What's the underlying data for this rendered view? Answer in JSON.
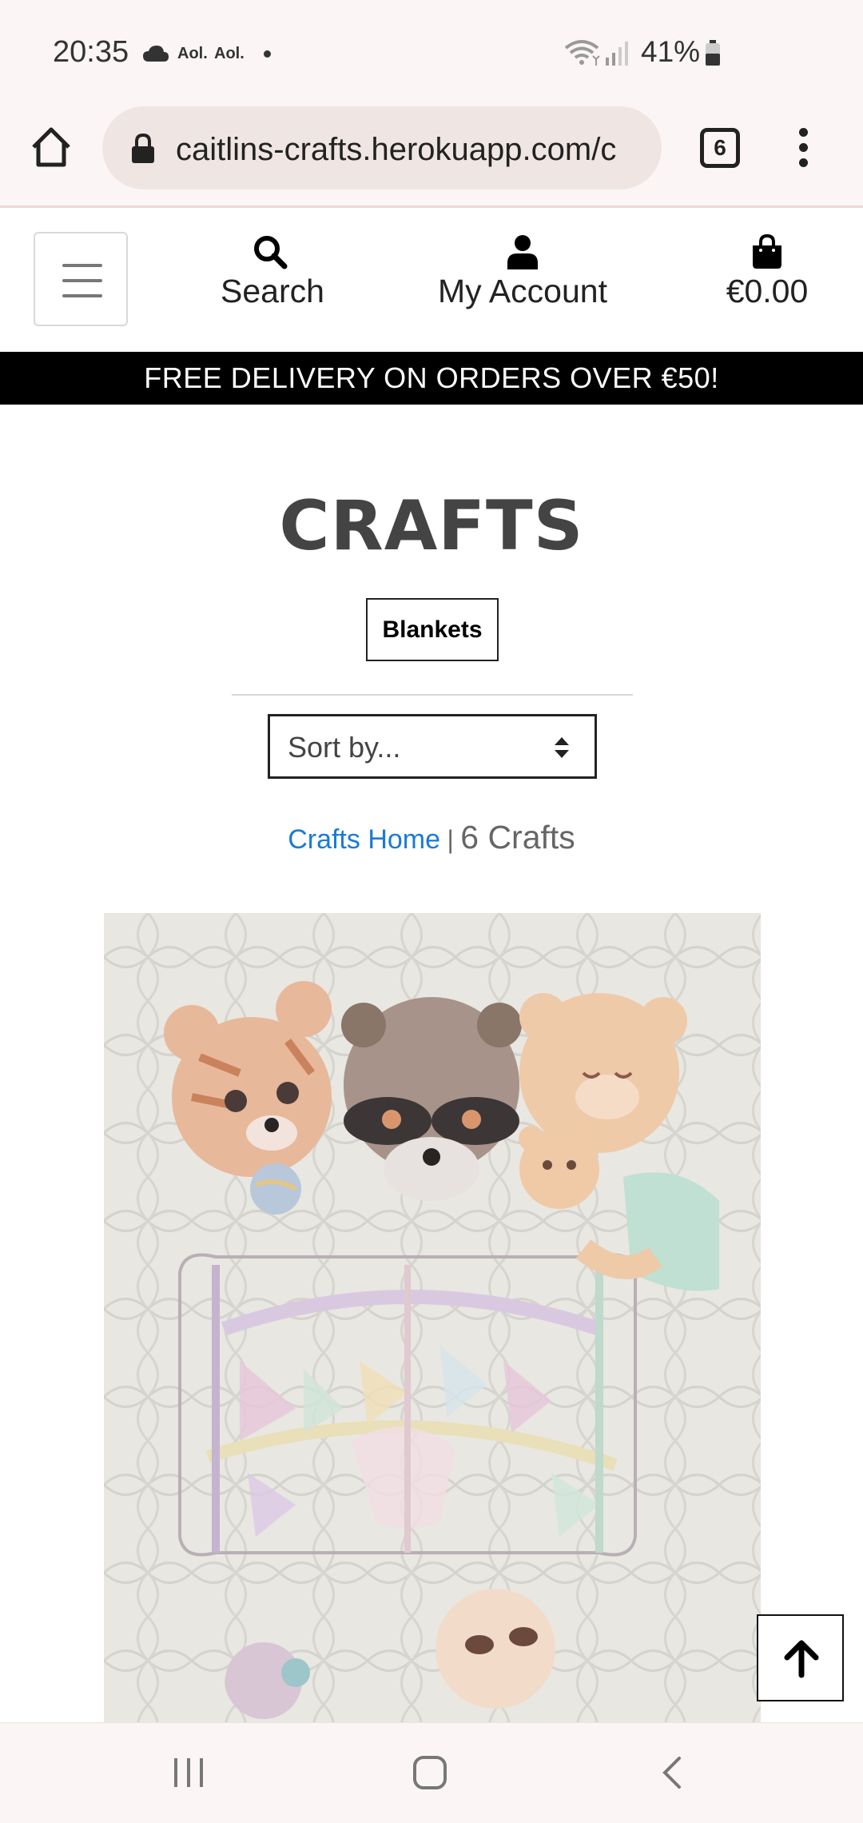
{
  "status_bar": {
    "time": "20:35",
    "notif_1": "Aol.",
    "notif_2": "Aol.",
    "battery": "41%"
  },
  "browser": {
    "url": "caitlins-crafts.herokuapp.com/c",
    "tab_count": "6"
  },
  "header": {
    "search_label": "Search",
    "account_label": "My Account",
    "cart_total": "€0.00"
  },
  "promo": {
    "text": "FREE DELIVERY ON ORDERS OVER €50!"
  },
  "main": {
    "title": "CRAFTS",
    "category_badge": "Blankets",
    "sort_placeholder": "Sort by...",
    "breadcrumb_link": "Crafts Home",
    "breadcrumb_separator": "|",
    "result_count": "6 Crafts"
  },
  "colors": {
    "link": "#1a7ad6",
    "promo_bg": "#000000",
    "chrome_bg": "#fbf6f5"
  },
  "icons": [
    "cloud-icon",
    "wifi-icon",
    "signal-icon",
    "battery-icon",
    "home-icon",
    "lock-icon",
    "kebab-menu-icon",
    "hamburger-icon",
    "search-icon",
    "user-icon",
    "shopping-bag-icon",
    "sort-arrows-icon",
    "arrow-up-icon",
    "recents-icon",
    "home-nav-icon",
    "back-icon"
  ]
}
